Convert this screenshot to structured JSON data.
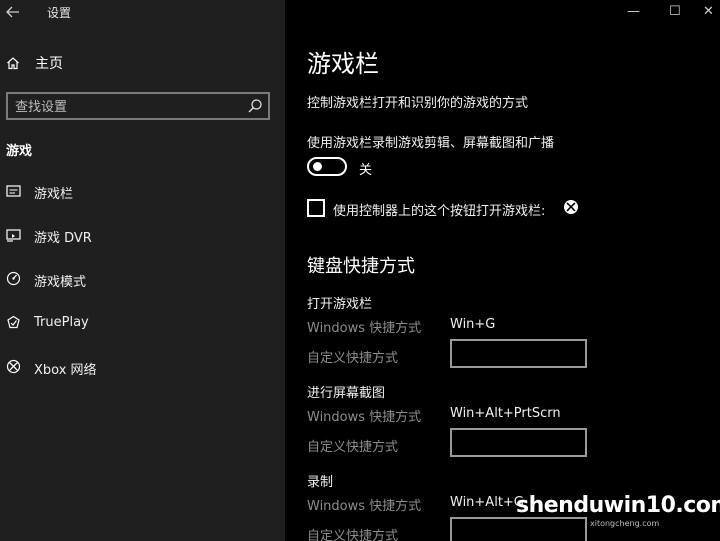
{
  "app": {
    "title": "设置"
  },
  "window_controls": {
    "minimize": "—",
    "maximize": "☐",
    "close": "✕"
  },
  "sidebar": {
    "home_label": "主页",
    "search_placeholder": "查找设置",
    "section_title": "游戏",
    "items": [
      {
        "label": "游戏栏",
        "icon": "game-bar-icon"
      },
      {
        "label": "游戏 DVR",
        "icon": "dvr-icon"
      },
      {
        "label": "游戏模式",
        "icon": "game-mode-icon"
      },
      {
        "label": "TruePlay",
        "icon": "trueplay-icon"
      },
      {
        "label": "Xbox 网络",
        "icon": "xbox-icon"
      }
    ]
  },
  "main": {
    "title": "游戏栏",
    "description": "控制游戏栏打开和识别你的游戏的方式",
    "record_label": "使用游戏栏录制游戏剪辑、屏幕截图和广播",
    "toggle_state": "关",
    "checkbox_label": "使用控制器上的这个按钮打开游戏栏:",
    "keyboard_title": "键盘快捷方式",
    "shortcuts": [
      {
        "title": "打开游戏栏",
        "windows_label": "Windows 快捷方式",
        "windows_value": "Win+G",
        "custom_label": "自定义快捷方式",
        "custom_value": ""
      },
      {
        "title": "进行屏幕截图",
        "windows_label": "Windows 快捷方式",
        "windows_value": "Win+Alt+PrtScrn",
        "custom_label": "自定义快捷方式",
        "custom_value": ""
      },
      {
        "title": "录制",
        "windows_label": "Windows 快捷方式",
        "windows_value": "Win+Alt+G",
        "custom_label": "自定义快捷方式",
        "custom_value": ""
      }
    ]
  },
  "watermark": {
    "text": "shenduwin10.com",
    "sub": "xitongcheng.com"
  }
}
